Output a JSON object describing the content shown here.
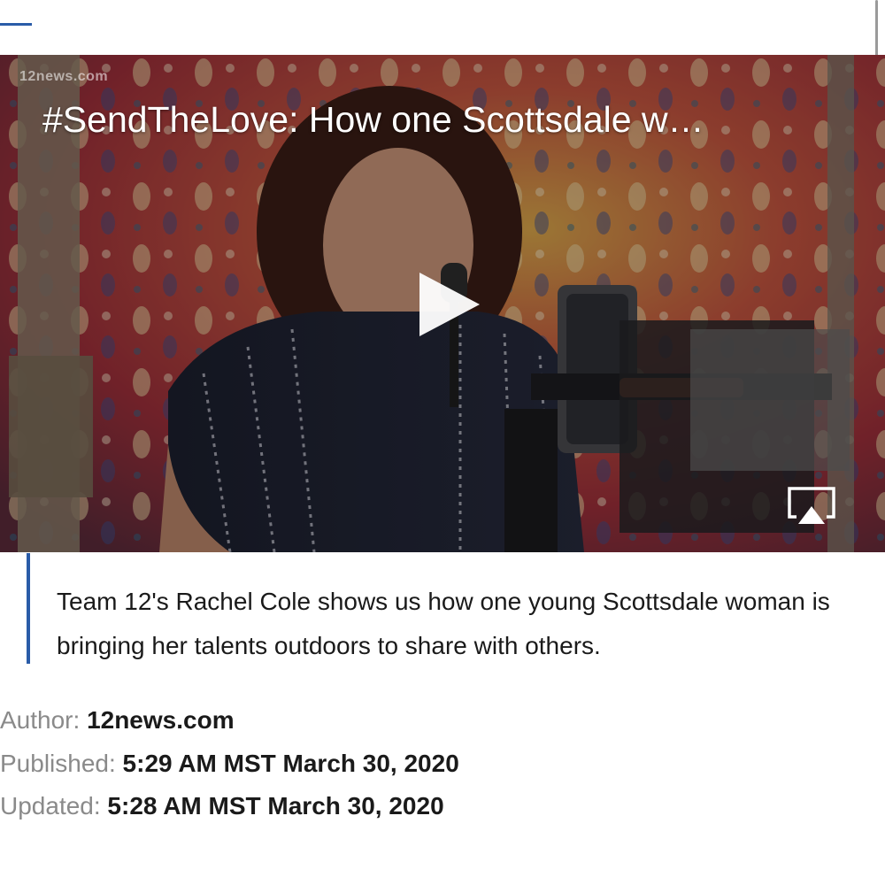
{
  "video": {
    "watermark": "12news.com",
    "title": "#SendTheLove: How one Scottsdale w…",
    "play_icon": "play-icon",
    "airplay_icon": "airplay-icon"
  },
  "caption": {
    "text": "Team 12's Rachel Cole shows us how one young Scottsdale woman is bringing her talents outdoors to share with others."
  },
  "meta": {
    "author_label": "Author: ",
    "author_value": "12news.com",
    "published_label": "Published: ",
    "published_value": "5:29 AM MST March 30, 2020",
    "updated_label": "Updated: ",
    "updated_value": "5:28 AM MST March 30, 2020"
  },
  "colors": {
    "accent": "#2a5ca8",
    "label_gray": "#8a8a8a",
    "text_dark": "#1a1a1a"
  }
}
